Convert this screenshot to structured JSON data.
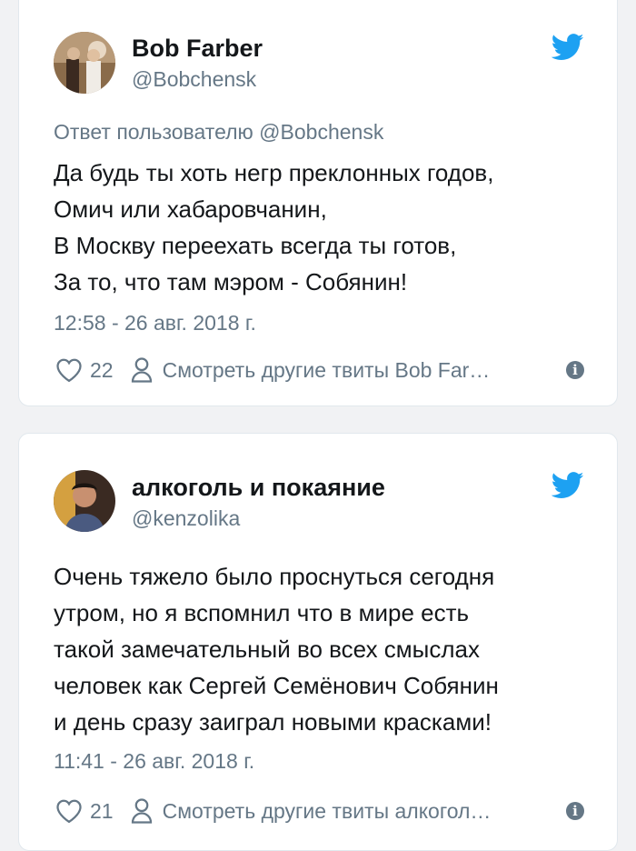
{
  "tweets": [
    {
      "name": "Bob Farber",
      "handle": "@Bobchensk",
      "reply_to": "Ответ пользователю @Bobchensk",
      "lines": [
        "Да будь ты хоть негр преклонных годов,",
        "Омич или хабаровчанин,",
        "В Москву переехать всегда ты готов,",
        "За то, что там мэром - Собянин!"
      ],
      "time": "12:58 - 26 авг. 2018 г.",
      "likes": "22",
      "more_label": "Смотреть другие твиты Bob Far…",
      "icons": {
        "platform": "twitter-bird-icon",
        "like": "heart-icon",
        "more": "person-icon",
        "info": "info-icon"
      }
    },
    {
      "name": "алкоголь и покаяние",
      "handle": "@kenzolika",
      "lines": [
        "Очень тяжело было проснуться сегодня",
        "утром, но я вспомнил что в мире есть",
        "такой замечательный во всех смыслах",
        "человек как Сергей Семёнович Собянин",
        "и день сразу заиграл новыми красками!"
      ],
      "time": "11:41 - 26 авг. 2018 г.",
      "likes": "21",
      "more_label": "Смотреть другие твиты алкогол…",
      "icons": {
        "platform": "twitter-bird-icon",
        "like": "heart-icon",
        "more": "person-icon",
        "info": "info-icon"
      }
    }
  ],
  "colors": {
    "twitter_blue": "#1da1f2",
    "secondary_text": "#657786",
    "primary_text": "#14171a",
    "card_border": "#e1e8ed",
    "background": "#f1f2f4"
  }
}
